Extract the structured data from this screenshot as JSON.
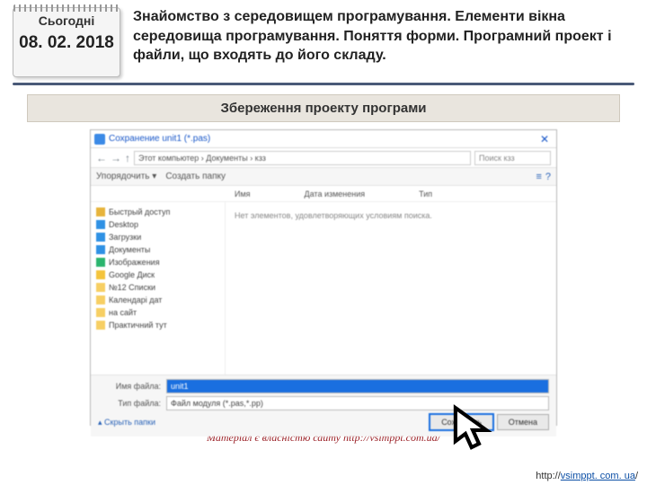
{
  "header": {
    "today_label": "Сьогодні",
    "date": "08. 02. 2018",
    "lesson_title": "Знайомство з середовищем програмування. Елементи вікна середовища програмування. Поняття форми. Програмний проект і файли, що входять до його складу."
  },
  "subtitle": "Збереження проекту програми",
  "dialog": {
    "title": "Сохранение unit1 (*.pas)",
    "nav": {
      "back": "←",
      "fwd": "→",
      "up": "↑",
      "path": "Этот компьютер  ›  Документы  ›  кзз",
      "search_placeholder": "Поиск кзз"
    },
    "toolbar": {
      "organize": "Упорядочить ▾",
      "newfolder": "Создать папку",
      "icon1": "≡",
      "icon2": "?"
    },
    "cols": {
      "name": "Имя",
      "date": "Дата изменения",
      "type": "Тип"
    },
    "side": {
      "quick": "Быстрый доступ",
      "desktop": "Desktop",
      "downloads": "Загрузки",
      "documents": "Документы",
      "pictures": "Изображения",
      "gdrive": "Google Диск",
      "lists": "№12 Списки",
      "today": "Календарі дат",
      "site": "на сайт",
      "practical": "Практичний тут"
    },
    "empty": "Нет элементов, удовлетворяющих условиям поиска.",
    "filename_label": "Имя файла:",
    "filename_value": "unit1",
    "filetype_label": "Тип файла:",
    "filetype_value": "Файл модуля (*.pas,*.pp)",
    "hide": "Скрыть папки",
    "save": "Сохранить",
    "cancel": "Отмена"
  },
  "credit": "Матеріал є власністю сайту http://vsimppt.com.ua/",
  "footer_url_prefix": "http://",
  "footer_url_link": "vsimppt. com. ua",
  "footer_url_suffix": "/"
}
